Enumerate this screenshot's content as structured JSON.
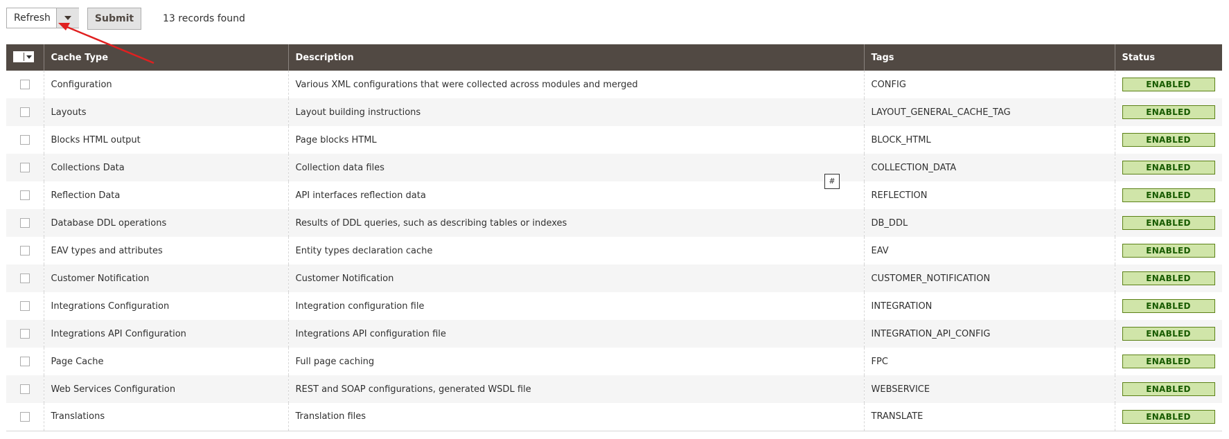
{
  "toolbar": {
    "action_value": "Refresh",
    "submit_label": "Submit",
    "records_count": "13 records found"
  },
  "columns": [
    "Cache Type",
    "Description",
    "Tags",
    "Status"
  ],
  "tooltip_text": "#",
  "colors": {
    "header_bg": "#514943",
    "status_bg": "#d0e5a9",
    "status_border": "#5b8116",
    "status_text": "#185b00",
    "annotation_arrow": "#e02020"
  },
  "rows": [
    {
      "type": "Configuration",
      "description": "Various XML configurations that were collected across modules and merged",
      "tags": "CONFIG",
      "status": "ENABLED"
    },
    {
      "type": "Layouts",
      "description": "Layout building instructions",
      "tags": "LAYOUT_GENERAL_CACHE_TAG",
      "status": "ENABLED"
    },
    {
      "type": "Blocks HTML output",
      "description": "Page blocks HTML",
      "tags": "BLOCK_HTML",
      "status": "ENABLED"
    },
    {
      "type": "Collections Data",
      "description": "Collection data files",
      "tags": "COLLECTION_DATA",
      "status": "ENABLED"
    },
    {
      "type": "Reflection Data",
      "description": "API interfaces reflection data",
      "tags": "REFLECTION",
      "status": "ENABLED"
    },
    {
      "type": "Database DDL operations",
      "description": "Results of DDL queries, such as describing tables or indexes",
      "tags": "DB_DDL",
      "status": "ENABLED"
    },
    {
      "type": "EAV types and attributes",
      "description": "Entity types declaration cache",
      "tags": "EAV",
      "status": "ENABLED"
    },
    {
      "type": "Customer Notification",
      "description": "Customer Notification",
      "tags": "CUSTOMER_NOTIFICATION",
      "status": "ENABLED"
    },
    {
      "type": "Integrations Configuration",
      "description": "Integration configuration file",
      "tags": "INTEGRATION",
      "status": "ENABLED"
    },
    {
      "type": "Integrations API Configuration",
      "description": "Integrations API configuration file",
      "tags": "INTEGRATION_API_CONFIG",
      "status": "ENABLED"
    },
    {
      "type": "Page Cache",
      "description": "Full page caching",
      "tags": "FPC",
      "status": "ENABLED"
    },
    {
      "type": "Web Services Configuration",
      "description": "REST and SOAP configurations, generated WSDL file",
      "tags": "WEBSERVICE",
      "status": "ENABLED"
    },
    {
      "type": "Translations",
      "description": "Translation files",
      "tags": "TRANSLATE",
      "status": "ENABLED"
    }
  ]
}
